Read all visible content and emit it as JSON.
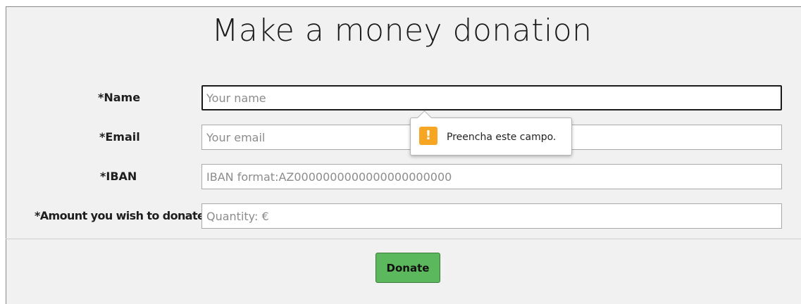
{
  "form": {
    "title": "Make a money donation",
    "fields": [
      {
        "label": "*Name",
        "placeholder": "Your name",
        "value": ""
      },
      {
        "label": "*Email",
        "placeholder": "Your email",
        "value": ""
      },
      {
        "label": "*IBAN",
        "placeholder": "IBAN format:AZ0000000000000000000000",
        "value": ""
      },
      {
        "label": "*Amount you wish to donate:",
        "placeholder": "Quantity: €",
        "value": ""
      }
    ],
    "submit_label": "Donate"
  },
  "validation_tooltip": {
    "message": "Preencha este campo.",
    "icon": "warning-icon",
    "icon_glyph": "!"
  },
  "colors": {
    "background": "#f1f1f1",
    "button": "#5cb85c",
    "warning": "#f6a623"
  }
}
